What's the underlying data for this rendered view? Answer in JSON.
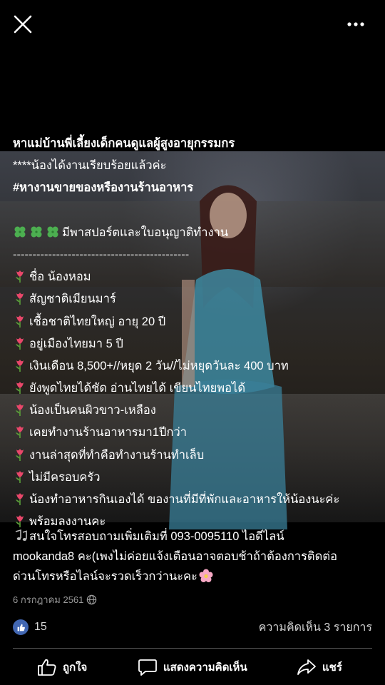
{
  "post": {
    "title": "หาแม่บ้านพี่เลี้ยงเด็กคนดูแลผู้สูงอายุกรรมกร",
    "status": "****น้องได้งานเรียบร้อยแล้วค่ะ",
    "hashtag": "#หางานขายของหรืองานร้านอาหาร",
    "passport": "มีพาสปอร์ตและใบอนุญาติทำงาน",
    "separator": "---------------------------------------------",
    "details": [
      "ชื่อ น้องหอม",
      "สัญชาติเมียนมาร์",
      "เชื้อชาติไทยใหญ่ อายุ 20 ปี",
      "อยู่เมืองไทยมา 5 ปี",
      "เงินเดือน 8,500+//หยุด 2 วัน//ไม่หยุดวันละ 400 บาท",
      "ยังพูดไทยได้ชัด อ่านไทยได้ เขียนไทยพอได้",
      "น้องเป็นคนผิวขาว-เหลือง",
      "เคยทำงานร้านอาหารมา1ปีกว่า",
      "งานล่าสุดที่ทำคือทำงานร้านทำเล็บ",
      "ไม่มีครอบครัว",
      "น้องทำอาหารกินเองได้ ของานที่มีที่พักและอาหารให้น้องนะค่ะ",
      "พร้อมลงงานคะ"
    ],
    "contact": [
      "สนใจโทรสอบถามเพิ่มเติมที่ 093-0095110 ไอดีไลน์",
      "mookanda8 คะ(เพงไม่ค่อยแจ้งเตือนอาจตอบช้าถ้าต้องการติดต่อ",
      "ด่วนโทรหรือไลน์จะรวดเร็วกว่านะคะ"
    ],
    "date": "6 กรกฎาคม 2561"
  },
  "stats": {
    "likes": "15",
    "comments": "ความคิดเห็น 3 รายการ"
  },
  "actions": {
    "like": "ถูกใจ",
    "comment": "แสดงความคิดเห็น",
    "share": "แชร์"
  },
  "icons": {
    "close": "close-icon",
    "more": "more-icon",
    "clover": "four-leaf-clover-icon",
    "tulip": "tulip-icon",
    "notes": "music-notes-icon",
    "blossom": "cherry-blossom-icon",
    "globe": "globe-icon"
  },
  "colors": {
    "accent": "#4267b2",
    "tulip": "#e8476a",
    "clover": "#4caf50"
  }
}
